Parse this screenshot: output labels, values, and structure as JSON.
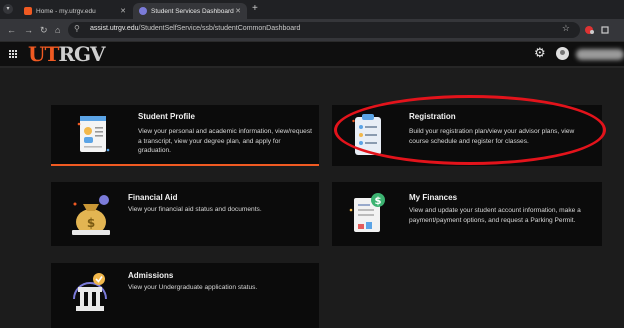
{
  "browser": {
    "tabs": [
      {
        "label": "Home - my.utrgv.edu",
        "active": false
      },
      {
        "label": "Student Services Dashboard",
        "active": true
      }
    ],
    "new_tab": "+",
    "url_host": "assist.utrgv.edu",
    "url_path": "/StudentSelfService/ssb/studentCommonDashboard"
  },
  "header": {
    "logo_ut": "UT",
    "logo_rgv": "RGV"
  },
  "cards": {
    "student_profile": {
      "title": "Student Profile",
      "description": "View your personal and academic information, view/request a transcript, view your degree plan, and apply for graduation."
    },
    "registration": {
      "title": "Registration",
      "description": "Build your registration plan/view your advisor plans, view course schedule and register for classes."
    },
    "financial_aid": {
      "title": "Financial Aid",
      "description": "View your financial aid status and documents."
    },
    "my_finances": {
      "title": "My Finances",
      "description": "View and update your student account information, make a payment/payment options, and request a Parking Permit."
    },
    "admissions": {
      "title": "Admissions",
      "description": "View your Undergraduate application status."
    }
  },
  "colors": {
    "brand_orange": "#f05a22",
    "annotation_red": "#e3131b"
  }
}
